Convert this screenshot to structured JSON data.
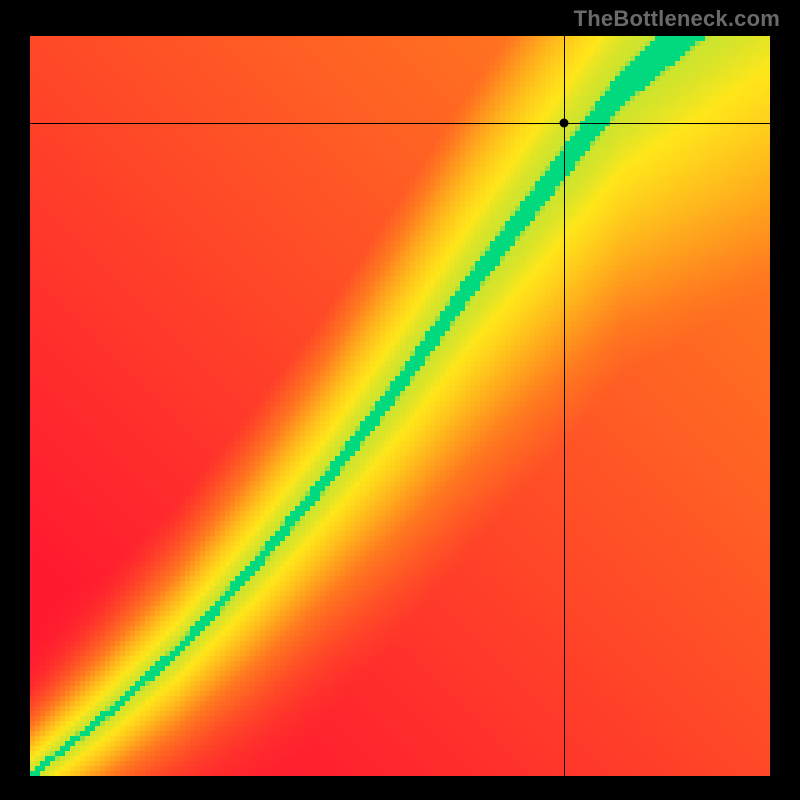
{
  "attribution": "TheBottleneck.com",
  "colors": {
    "background": "#000000",
    "attribution_text": "#6a6a6a",
    "gradient_stops": {
      "red": "#ff1a2f",
      "orange": "#ff7a1f",
      "yellow": "#ffe61a",
      "green": "#00d97e"
    }
  },
  "chart_data": {
    "type": "heatmap",
    "title": "",
    "xlabel": "",
    "ylabel": "",
    "xlim": [
      0,
      1
    ],
    "ylim": [
      0,
      1
    ],
    "grid": false,
    "legend": null,
    "description": "Continuous 2D field. Value ≈ 1 (green) along a curved ridge running diagonally from bottom-left to top-right, widening toward the top. Value falls to 0 (red) away from the ridge, with intermediate yellow/orange bands.",
    "ridge_samples_xy": [
      [
        0.0,
        0.0
      ],
      [
        0.1,
        0.08
      ],
      [
        0.2,
        0.17
      ],
      [
        0.3,
        0.28
      ],
      [
        0.4,
        0.4
      ],
      [
        0.5,
        0.53
      ],
      [
        0.6,
        0.67
      ],
      [
        0.7,
        0.8
      ],
      [
        0.8,
        0.93
      ],
      [
        0.88,
        1.0
      ]
    ],
    "ridge_halfwidth_samples": [
      [
        0.0,
        0.012
      ],
      [
        0.2,
        0.02
      ],
      [
        0.4,
        0.03
      ],
      [
        0.6,
        0.045
      ],
      [
        0.8,
        0.06
      ],
      [
        1.0,
        0.08
      ]
    ],
    "crosshair": {
      "x": 0.722,
      "y": 0.882
    },
    "marker": {
      "x": 0.722,
      "y": 0.882
    }
  }
}
